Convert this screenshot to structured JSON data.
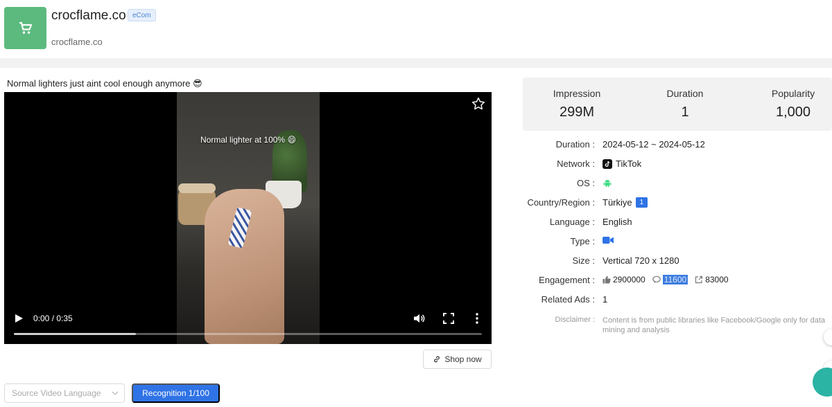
{
  "header": {
    "brand_name": "crocflame.co",
    "badge": "eCom",
    "domain": "crocflame.co"
  },
  "ad": {
    "title": "Normal lighters just aint cool enough anymore 😎",
    "video_caption": "Normal lighter at 100% 😄",
    "time": "0:00 / 0:35",
    "progress_fraction": 0.26
  },
  "actions": {
    "shop_now": "Shop now",
    "language_placeholder": "Source Video Language",
    "recognition": "Recognition 1/100"
  },
  "stats": [
    {
      "label": "Impression",
      "value": "299M"
    },
    {
      "label": "Duration",
      "value": "1"
    },
    {
      "label": "Popularity",
      "value": "1,000"
    }
  ],
  "details": {
    "duration": {
      "label": "Duration :",
      "value": "2024-05-12 ~ 2024-05-12"
    },
    "network": {
      "label": "Network :",
      "value": "TikTok"
    },
    "os": {
      "label": "OS :",
      "icon": "android-icon"
    },
    "country": {
      "label": "Country/Region :",
      "value": "Türkiye",
      "count": "1"
    },
    "language": {
      "label": "Language :",
      "value": "English"
    },
    "type": {
      "label": "Type :",
      "icon": "video-camera-icon"
    },
    "size": {
      "label": "Size :",
      "value": "Vertical 720 x 1280"
    },
    "engagement": {
      "label": "Engagement :",
      "likes": "2900000",
      "comments": "11600",
      "shares": "83000"
    },
    "related": {
      "label": "Related Ads :",
      "value": "1"
    },
    "disclaimer": {
      "label": "Disclaimer :",
      "value": "Content is from public libraries like Facebook/Google only for data mining and analysis"
    }
  },
  "colors": {
    "accent": "#2f73e6",
    "logo_bg": "#5cba7f",
    "android": "#3ddc84"
  }
}
